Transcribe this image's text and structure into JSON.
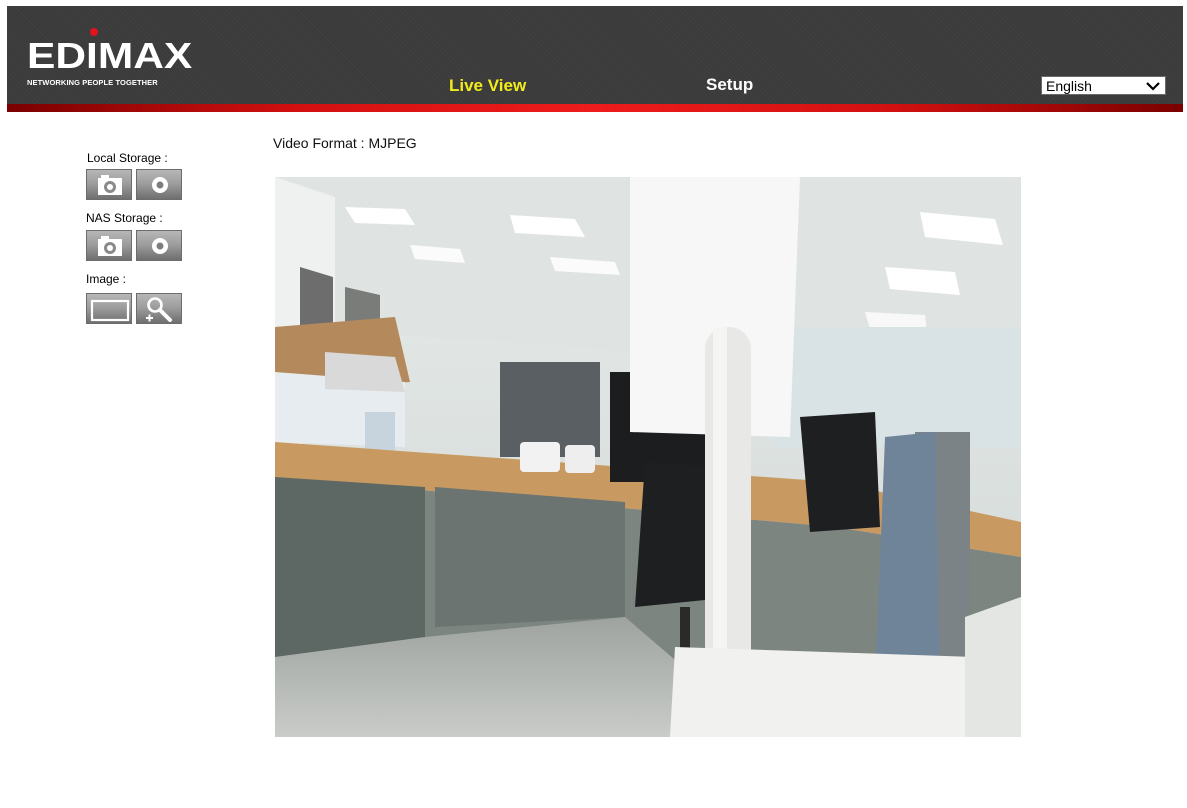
{
  "header": {
    "logo_text": "EDIMAX",
    "logo_tagline": "NETWORKING PEOPLE TOGETHER",
    "nav": {
      "live_view": "Live View",
      "setup": "Setup"
    },
    "language": {
      "selected": "English",
      "options": [
        "English"
      ]
    }
  },
  "sidebar": {
    "local_storage_label": "Local Storage :",
    "nas_storage_label": "NAS Storage :",
    "image_label": "Image :",
    "buttons": {
      "local_snapshot": "camera-icon",
      "local_record": "record-icon",
      "nas_snapshot": "camera-icon",
      "nas_record": "record-icon",
      "image_fullscreen": "fullscreen-icon",
      "image_zoom": "zoom-icon"
    }
  },
  "main": {
    "video_format": "Video Format : MJPEG"
  },
  "colors": {
    "header_bg": "#3b3b3b",
    "accent_red": "#e1141c",
    "live_view_active": "#f2ec1b"
  }
}
